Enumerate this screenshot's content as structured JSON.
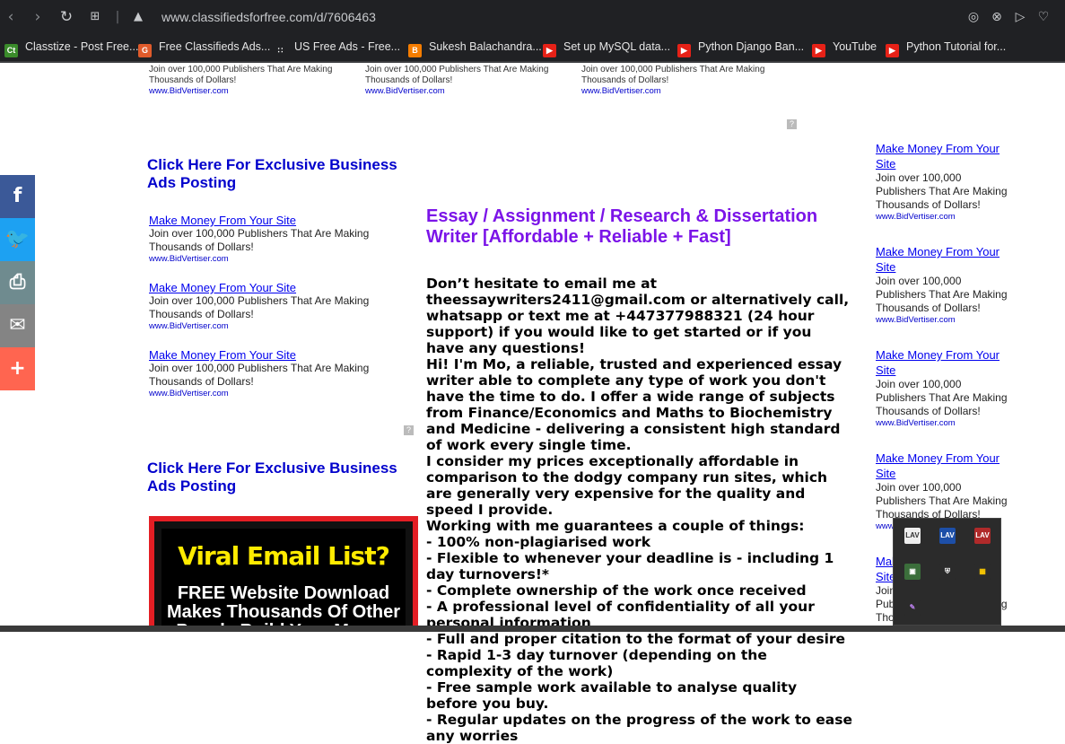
{
  "browser": {
    "url": "www.classifiedsforfree.com/d/7606463",
    "bookmarks": [
      {
        "label": "Classtize - Post Free...",
        "icon": "classtize-icon",
        "icon_text": "Ct",
        "icon_color": "#3a8b2b"
      },
      {
        "label": "Free Classifieds Ads...",
        "icon": "fca-icon",
        "icon_text": "G",
        "icon_color": "#e05b2b"
      },
      {
        "label": "US Free Ads - Free...",
        "icon": "dots-icon",
        "icon_text": "∷",
        "icon_color": "#202124"
      },
      {
        "label": "Sukesh Balachandra...",
        "icon": "blogger-icon",
        "icon_text": "B",
        "icon_color": "#f57d00"
      },
      {
        "label": "Set up MySQL data...",
        "icon": "youtube-icon",
        "icon_text": "▶",
        "icon_color": "#e62117"
      },
      {
        "label": "Python Django Ban...",
        "icon": "youtube-icon",
        "icon_text": "▶",
        "icon_color": "#e62117"
      },
      {
        "label": "YouTube",
        "icon": "youtube-icon",
        "icon_text": "▶",
        "icon_color": "#e62117"
      },
      {
        "label": "Python Tutorial for...",
        "icon": "youtube-icon",
        "icon_text": "▶",
        "icon_color": "#e62117"
      }
    ]
  },
  "ads": {
    "title": "Make Money From Your Site",
    "body": "Join over 100,000 Publishers That Are Making Thousands of Dollars!",
    "url": "www.BidVertiser.com",
    "exclusive": "Click Here For Exclusive Business Ads Posting"
  },
  "main": {
    "title": "Essay / Assignment / Research & Dissertation Writer [Affordable + Reliable + Fast]",
    "paragraphs": [
      "Don’t hesitate to email me at theessaywriters2411@gmail.com or alternatively call, whatsapp or text me at +447377988321 (24 hour support) if you would like to get started or if you have any questions!",
      "Hi! I'm Mo, a reliable, trusted and experienced essay writer able to complete any type of work you don't have the time to do. I offer a wide range of subjects from Finance/Economics and Maths to Biochemistry and Medicine - delivering a consistent high standard of work every single time.",
      "I consider my prices exceptionally affordable in comparison to the dodgy company run sites, which are generally very expensive for the quality and speed I provide.",
      "Working with me guarantees a couple of things:",
      "- 100% non-plagiarised work",
      "- Flexible to whenever your deadline is - including 1 day turnovers!*",
      "- Complete ownership of the work once received",
      "- A professional level of confidentiality of all your personal information",
      "- Full and proper citation to the format of your desire",
      "- Rapid 1-3 day turnover (depending on the complexity of the work)",
      "- Free sample work available to analyse quality before you buy.",
      "- Regular updates on the progress of the work to ease any worries"
    ]
  },
  "banner": {
    "headline": "Viral Email List?",
    "text": "FREE Website Download Makes Thousands Of Other People Build Your Money"
  },
  "share": [
    {
      "name": "facebook-share",
      "glyph": "f",
      "color": "#3b5998"
    },
    {
      "name": "twitter-share",
      "glyph": "🐦",
      "color": "#1da1f2"
    },
    {
      "name": "print-share",
      "glyph": "⎙",
      "color": "#6f8b8f"
    },
    {
      "name": "email-share",
      "glyph": "✉",
      "color": "#848484"
    },
    {
      "name": "more-share",
      "glyph": "+",
      "color": "#ff6550"
    }
  ],
  "tray": [
    {
      "icon": "lav-icon",
      "text": "LAV",
      "color": "#eeeeee",
      "fg": "#333"
    },
    {
      "icon": "lav-icon",
      "text": "LAV",
      "color": "#1d4fa8",
      "fg": "#fff"
    },
    {
      "icon": "lav-icon",
      "text": "LAV",
      "color": "#b02a2a",
      "fg": "#fff"
    },
    {
      "icon": "network-icon",
      "text": "▣",
      "color": "#3b6e3b",
      "fg": "#fff"
    },
    {
      "icon": "security-shield-icon",
      "text": "⛨",
      "color": "#2b2b2b",
      "fg": "#fff"
    },
    {
      "icon": "color-grid-icon",
      "text": "▦",
      "color": "#2b2b2b",
      "fg": "#ffcc00"
    },
    {
      "icon": "feather-icon",
      "text": "✎",
      "color": "#2b2b2b",
      "fg": "#b77ee8"
    }
  ]
}
